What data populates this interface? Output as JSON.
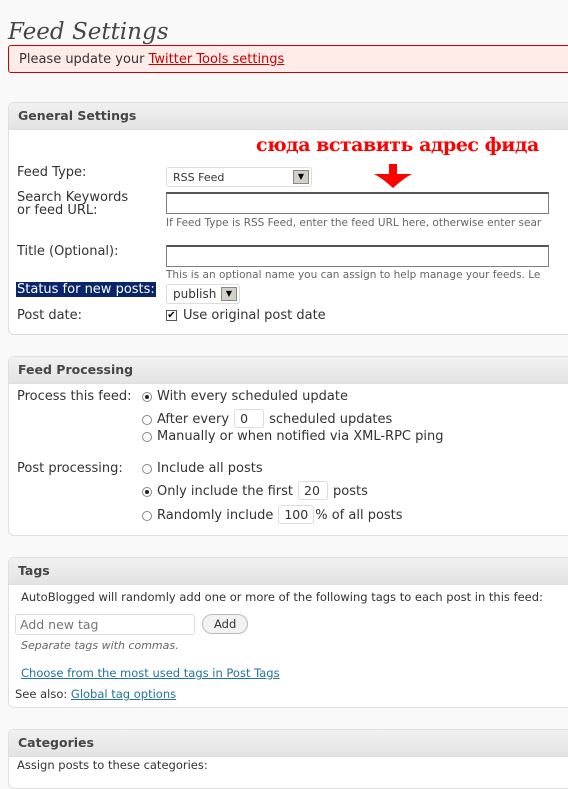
{
  "page": {
    "title": "Feed Settings"
  },
  "notice": {
    "text": "Please update your ",
    "link": "Twitter Tools settings"
  },
  "annotation": {
    "text": "сюда вставить адрес фида",
    "color": "#ff0000"
  },
  "general": {
    "heading": "General Settings",
    "feed_type_label": "Feed Type:",
    "feed_type_value": "RSS Feed",
    "search_label_1": "Search Keywords",
    "search_label_2": "or feed URL:",
    "search_value": "",
    "search_hint": "If Feed Type is RSS Feed, enter the feed URL here, otherwise enter sear",
    "title_label": "Title (Optional):",
    "title_value": "",
    "title_hint": "This is an optional name you can assign to help manage your feeds. Le",
    "status_label": "Status for new posts:",
    "status_value": "publish",
    "post_date_label": "Post date:",
    "post_date_option": "Use original post date",
    "post_date_checked": true
  },
  "processing": {
    "heading": "Feed Processing",
    "process_label": "Process this feed:",
    "opt_every": "With every scheduled update",
    "opt_after_prefix": "After every",
    "opt_after_value": "0",
    "opt_after_suffix": "scheduled updates",
    "opt_manual": "Manually or when notified via XML-RPC ping",
    "post_label": "Post processing:",
    "opt_all": "Include all posts",
    "opt_first_prefix": "Only include the first",
    "opt_first_value": "20",
    "opt_first_suffix": "posts",
    "opt_random_prefix": "Randomly include",
    "opt_random_value": "100",
    "opt_random_suffix": "% of all posts"
  },
  "tags": {
    "heading": "Tags",
    "description": "AutoBlogged will randomly add one or more of the following tags to each post in this feed:",
    "input_placeholder": "Add new tag",
    "add_button": "Add",
    "hint": "Separate tags with commas.",
    "choose_link": "Choose from the most used tags in Post Tags",
    "see_also": "See also: ",
    "global_link": "Global tag options"
  },
  "categories": {
    "heading": "Categories",
    "description": "Assign posts to these categories:"
  }
}
